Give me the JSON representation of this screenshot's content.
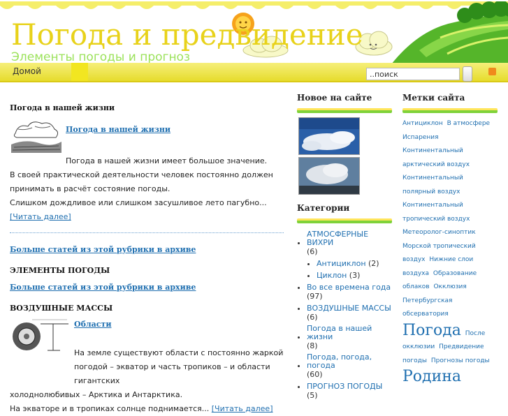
{
  "header": {
    "title": "Погода и предвидение",
    "subtitle": "Элементы погоды и прогноз"
  },
  "nav": {
    "home": "Домой"
  },
  "search": {
    "value": "..поиск"
  },
  "main": {
    "section1_title": "Погода в нашей жизни",
    "article1": {
      "title": "Погода в нашей жизни",
      "lines": [
        "Погода в нашей жизни имеет большое значение.",
        "В своей практической деятельности человек постоянно должен",
        "принимать в расчёт состояние погоды.",
        "Слишком дождливое или слишком засушливое лето пагубно..."
      ],
      "read_more": "[Читать далее]"
    },
    "more_archive": "Больше статей из этой рубрики в архиве",
    "section2_title": "ЭЛЕМЕНТЫ ПОГОДЫ",
    "section3_title": "ВОЗДУШНЫЕ МАССЫ",
    "article2": {
      "title": "Области",
      "lines": [
        "На земле существуют области с постоянно жаркой",
        "погодой – экватор и часть тропиков – и области гигантских",
        "холоднолюбивых – Арктика и Антарктика.",
        "На экваторе и в тропиках солнце поднимается..."
      ],
      "read_more": "[Читать далее]"
    }
  },
  "sidebar_new": {
    "title": "Новое на сайте"
  },
  "sidebar_categories": {
    "title": "Категории",
    "items": [
      {
        "label": "АТМОСФЕРНЫЕ ВИХРИ",
        "count": "(6)"
      },
      {
        "label": "Антициклон",
        "count": "(2)"
      },
      {
        "label": "Циклон",
        "count": "(3)"
      },
      {
        "label": "Во все времена года",
        "count": "(97)"
      },
      {
        "label": "ВОЗДУШНЫЕ МАССЫ",
        "count": "(6)"
      },
      {
        "label": "Погода в нашей жизни",
        "count": "(8)"
      },
      {
        "label": "Погода, погода, погода",
        "count": "(60)"
      },
      {
        "label": "ПРОГНОЗ ПОГОДЫ",
        "count": "(5)"
      }
    ]
  },
  "sidebar_tags": {
    "title": "Метки сайта",
    "tags": [
      "Антициклон",
      "В атмосфере",
      "Испарения",
      "Континентальный арктический воздух",
      "Континентальный полярный воздух",
      "Континентальный тропический воздух",
      "Метеоролог-синоптик",
      "Морской тропический воздух",
      "Нижние слои воздуха",
      "Образование облаков",
      "Окклюзия",
      "Петербургская обсерватория",
      "Погода",
      "После окклюзии",
      "Предвидение погоды",
      "Прогнозы погоды",
      "Родина"
    ]
  },
  "colors": {
    "title": "#e8d21a",
    "subtitle": "#9be25a",
    "link": "#1f6fb0",
    "nav": "#f2e621"
  }
}
